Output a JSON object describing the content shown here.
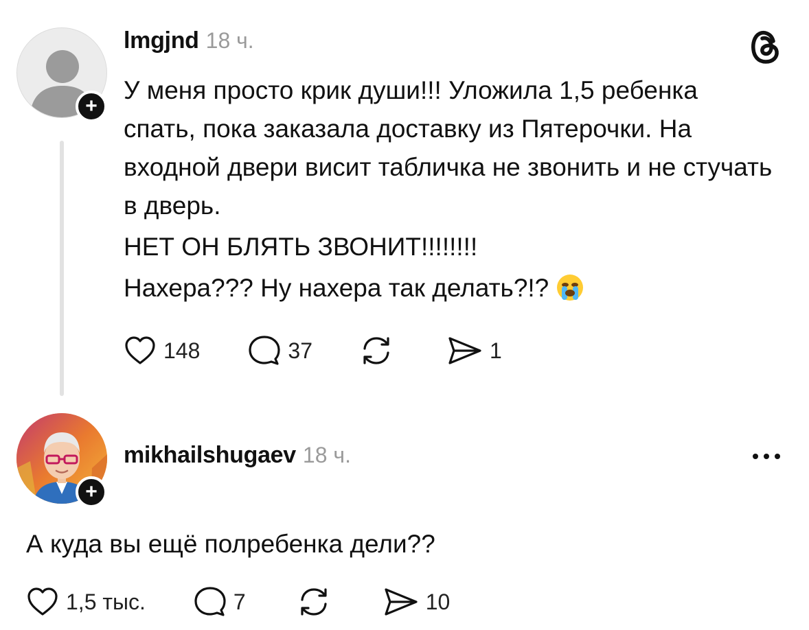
{
  "post": {
    "username": "lmgjnd",
    "time": "18 ч.",
    "lines": [
      "У меня просто крик души!!! Уложила 1,5 ребенка спать, пока заказала доставку из Пятерочки. На входной двери висит табличка не звонить и не стучать в дверь.",
      "НЕТ ОН БЛЯТЬ ЗВОНИТ!!!!!!!!",
      "Нахера??? Ну нахера так делать?!?"
    ],
    "emoji": "crying-face-emoji",
    "likes": "148",
    "comments": "37",
    "shares": "1"
  },
  "reply": {
    "username": "mikhailshugaev",
    "time": "18 ч.",
    "text": "А куда вы ещё полребенка дели??",
    "likes": "1,5 тыс.",
    "comments": "7",
    "shares": "10"
  },
  "icons": {
    "app_logo": "threads-icon",
    "like": "heart-icon",
    "comment": "comment-icon",
    "repost": "repost-icon",
    "share": "send-icon",
    "more": "more-icon",
    "follow": "plus-icon"
  },
  "colors": {
    "text": "#111111",
    "muted": "#9a9a9a",
    "thread_line": "#e2e2e2",
    "badge": "#111111"
  }
}
